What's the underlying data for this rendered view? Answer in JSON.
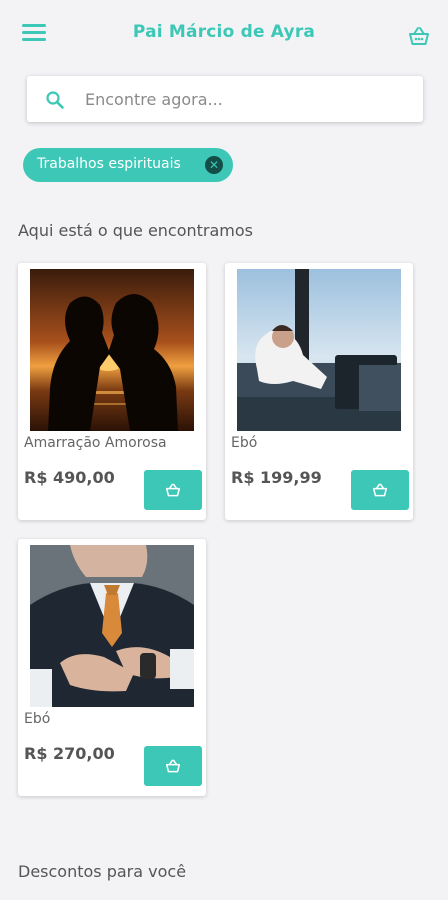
{
  "header": {
    "title": "Pai Márcio de Ayra",
    "menu_icon": "hamburger-menu-icon",
    "cart_icon": "basket-icon"
  },
  "search": {
    "placeholder": "Encontre agora...",
    "value": "",
    "icon": "search-icon"
  },
  "filter_chip": {
    "label": "Trabalhos espirituais",
    "close_icon": "close-circle-icon"
  },
  "results": {
    "heading": "Aqui está o que encontramos",
    "products": [
      {
        "name": "Amarração Amorosa",
        "price": "R$ 490,00",
        "image": "couple-kissing-sunset"
      },
      {
        "name": "Ebó",
        "price": "R$ 199,99",
        "image": "man-relaxing-at-desk"
      },
      {
        "name": "Ebó",
        "price": "R$ 270,00",
        "image": "businessman-adjusting-watch"
      }
    ]
  },
  "discounts": {
    "heading": "Descontos para você"
  },
  "colors": {
    "accent": "#3cc7b6",
    "background": "#f3f3f6"
  }
}
